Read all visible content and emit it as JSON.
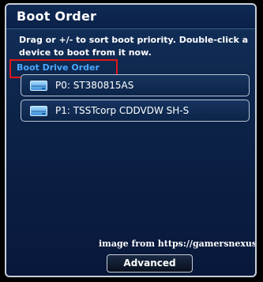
{
  "dialog": {
    "title": "Boot Order",
    "instructions": "Drag or +/- to sort boot priority. Double-click a device to boot from it now."
  },
  "boot_drive_order": {
    "label": "Boot Drive Order",
    "highlight_color": "#e01818",
    "label_color": "#4aa8ff",
    "items": [
      {
        "label": "P0: ST380815AS",
        "icon": "hard-drive-icon"
      },
      {
        "label": "P1: TSSTcorp CDDVDW SH-S",
        "icon": "hard-drive-icon"
      }
    ]
  },
  "watermark": "image from https://gamersnexus.net/",
  "buttons": {
    "advanced_label": "Advanced"
  },
  "colors": {
    "panel_background": "#0c2247",
    "panel_border": "#c8ced8"
  }
}
